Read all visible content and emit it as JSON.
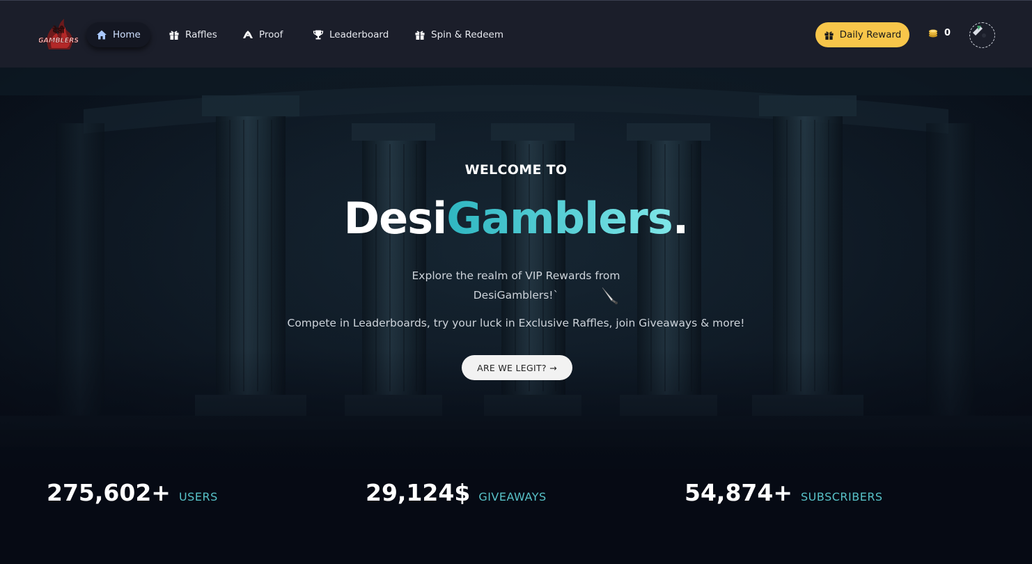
{
  "nav": {
    "items": [
      {
        "label": "Home",
        "icon": "home-icon",
        "active": true
      },
      {
        "label": "Raffles",
        "icon": "gift-icon"
      },
      {
        "label": "Proof",
        "icon": "handshake-icon"
      },
      {
        "label": "Leaderboard",
        "icon": "trophy-icon"
      },
      {
        "label": "Spin & Redeem",
        "icon": "gift-icon"
      }
    ],
    "daily_reward": "Daily Reward",
    "coins": "0",
    "logo_text": "देसी GAMBLERS"
  },
  "hero": {
    "welcome": "WELCOME TO",
    "brand_white": "Desi",
    "brand_gradient": "Gamblers",
    "brand_dot": ".",
    "tagline": "Explore the realm of VIP Rewards from DesiGamblers!`",
    "subtitle": "Compete in Leaderboards, try your luck in Exclusive Raffles, join Giveaways & more!",
    "cta": "ARE WE LEGIT?  →"
  },
  "stats": [
    {
      "value": "275,602+",
      "label": "USERS"
    },
    {
      "value": "29,124$",
      "label": "GIVEAWAYS"
    },
    {
      "value": "54,874+",
      "label": "SUBSCRIBERS"
    }
  ],
  "colors": {
    "accent": "#58c2c9",
    "reward": "#f8c64a",
    "nav_bg": "#1b1e2a"
  }
}
